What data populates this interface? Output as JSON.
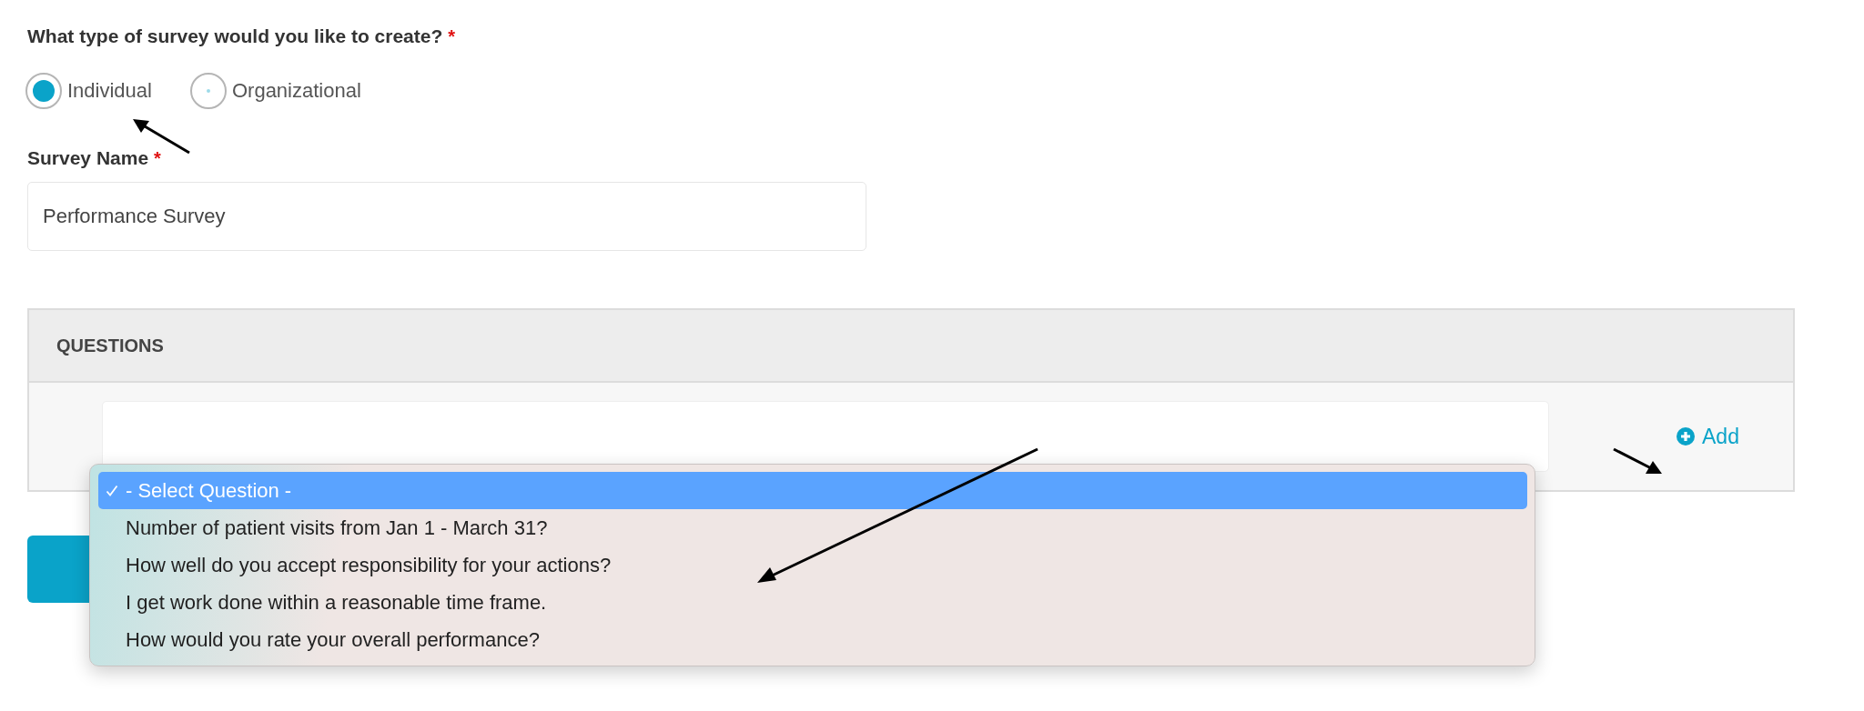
{
  "survey_type": {
    "label": "What type of survey would you like to create?",
    "required_mark": "*",
    "options": [
      {
        "label": "Individual",
        "selected": true
      },
      {
        "label": "Organizational",
        "selected": false
      }
    ]
  },
  "survey_name": {
    "label": "Survey Name",
    "required_mark": "*",
    "value": "Performance Survey"
  },
  "questions_panel": {
    "title": "QUESTIONS",
    "add_link": "Add",
    "dropdown_options": [
      {
        "label": "- Select Question -",
        "selected": true
      },
      {
        "label": "Number of patient visits from Jan 1 - March 31?",
        "selected": false
      },
      {
        "label": "How well do you accept responsibility for your actions?",
        "selected": false
      },
      {
        "label": "I get work done within a reasonable time frame.",
        "selected": false
      },
      {
        "label": "How would you rate your overall performance?",
        "selected": false
      }
    ]
  }
}
